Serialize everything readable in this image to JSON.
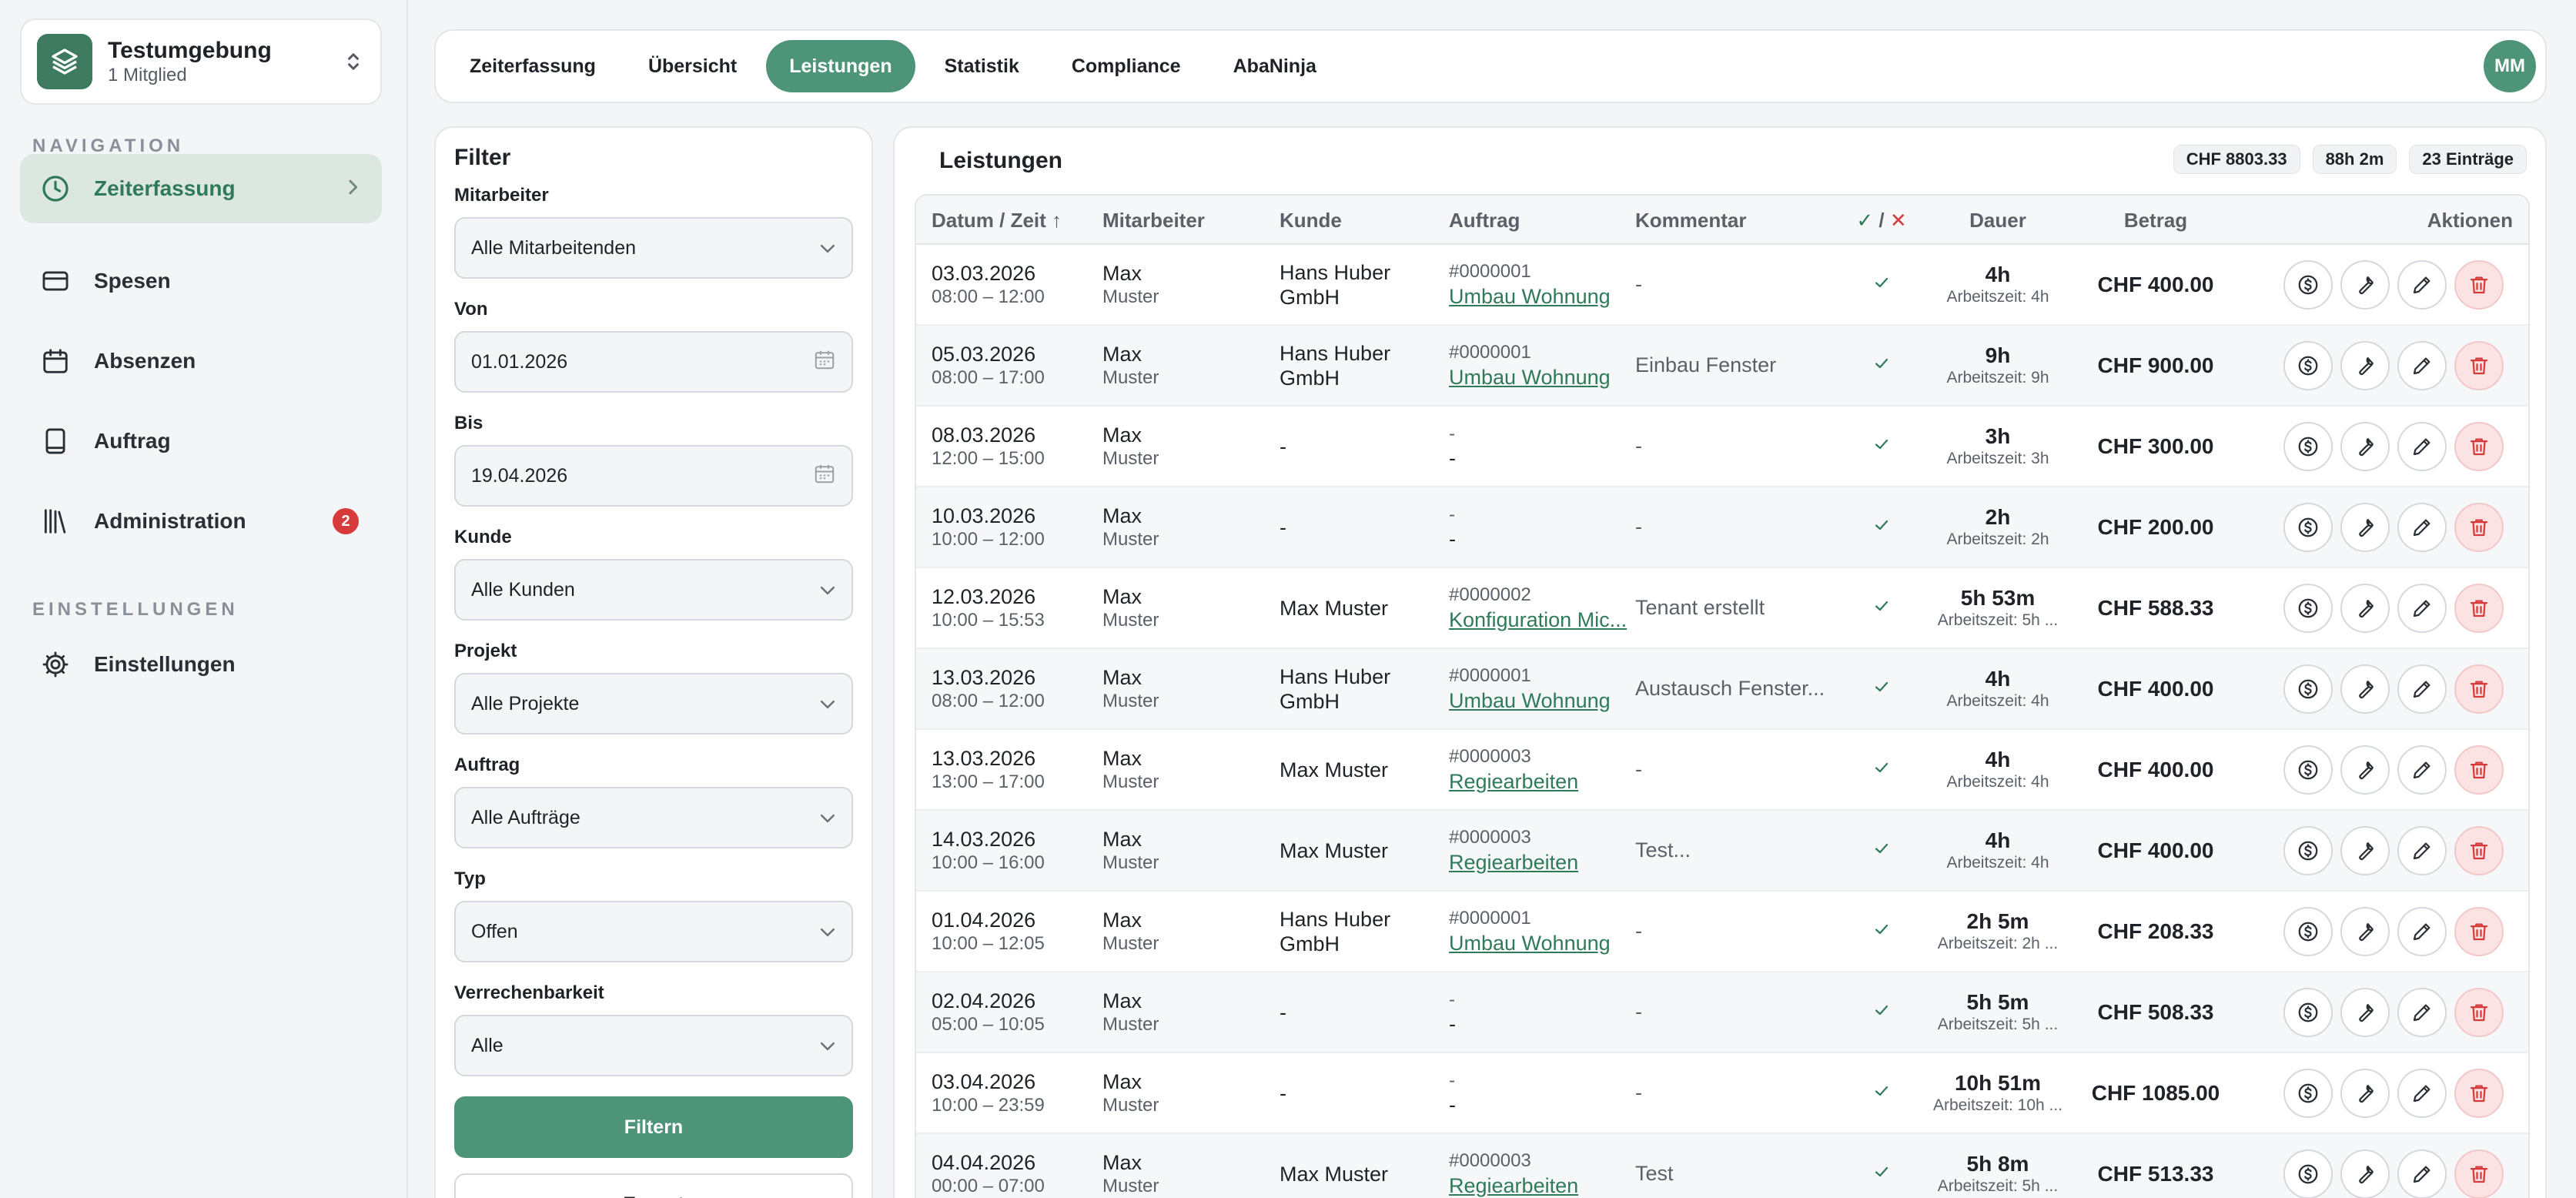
{
  "workspace": {
    "title": "Testumgebung",
    "subtitle": "1 Mitglied"
  },
  "sidebar": {
    "nav_heading": "NAVIGATION",
    "settings_heading": "EINSTELLUNGEN",
    "items": [
      {
        "label": "Zeiterfassung",
        "icon": "clock-icon",
        "active": true
      },
      {
        "label": "Spesen",
        "icon": "credit-card-icon"
      },
      {
        "label": "Absenzen",
        "icon": "calendar-icon"
      },
      {
        "label": "Auftrag",
        "icon": "tablet-icon"
      },
      {
        "label": "Administration",
        "icon": "library-icon",
        "badge": "2"
      }
    ],
    "settings_item": {
      "label": "Einstellungen",
      "icon": "gear-icon"
    }
  },
  "tabs": [
    {
      "label": "Zeiterfassung"
    },
    {
      "label": "Übersicht"
    },
    {
      "label": "Leistungen",
      "active": true
    },
    {
      "label": "Statistik"
    },
    {
      "label": "Compliance"
    },
    {
      "label": "AbaNinja"
    }
  ],
  "user": {
    "initials": "MM"
  },
  "filter": {
    "title": "Filter",
    "employee": {
      "label": "Mitarbeiter",
      "value": "Alle Mitarbeitenden"
    },
    "from": {
      "label": "Von",
      "value": "01.01.2026"
    },
    "to": {
      "label": "Bis",
      "value": "19.04.2026"
    },
    "customer": {
      "label": "Kunde",
      "value": "Alle Kunden"
    },
    "project": {
      "label": "Projekt",
      "value": "Alle Projekte"
    },
    "order": {
      "label": "Auftrag",
      "value": "Alle Aufträge"
    },
    "type": {
      "label": "Typ",
      "value": "Offen"
    },
    "billable": {
      "label": "Verrechenbarkeit",
      "value": "Alle"
    },
    "filter_button": "Filtern",
    "export_button": "Export"
  },
  "main": {
    "title": "Leistungen",
    "summary": {
      "amount": "CHF 8803.33",
      "hours": "88h 2m",
      "entries": "23 Einträge"
    },
    "columns": {
      "date": "Datum / Zeit ↑",
      "employee": "Mitarbeiter",
      "customer": "Kunde",
      "order": "Auftrag",
      "comment": "Kommentar",
      "status_check": "✓",
      "status_sep": " / ",
      "status_x": "✕",
      "duration": "Dauer",
      "amount": "Betrag",
      "actions": "Aktionen"
    },
    "rows": [
      {
        "date": "03.03.2026",
        "time": "08:00 – 12:00",
        "emp1": "Max",
        "emp2": "Muster",
        "cust1": "Hans Huber",
        "cust2": "GmbH",
        "order_no": "#0000001",
        "order_name": "Umbau Wohnung",
        "comment": "-",
        "dur": "4h",
        "dur_sub": "Arbeitszeit: 4h",
        "amount": "CHF 400.00"
      },
      {
        "date": "05.03.2026",
        "time": "08:00 – 17:00",
        "emp1": "Max",
        "emp2": "Muster",
        "cust1": "Hans Huber",
        "cust2": "GmbH",
        "order_no": "#0000001",
        "order_name": "Umbau Wohnung",
        "comment": "Einbau Fenster",
        "dur": "9h",
        "dur_sub": "Arbeitszeit: 9h",
        "amount": "CHF 900.00"
      },
      {
        "date": "08.03.2026",
        "time": "12:00 – 15:00",
        "emp1": "Max",
        "emp2": "Muster",
        "cust1": "-",
        "cust2": "",
        "order_no": "-",
        "order_name": "-",
        "comment": "-",
        "dur": "3h",
        "dur_sub": "Arbeitszeit: 3h",
        "amount": "CHF 300.00"
      },
      {
        "date": "10.03.2026",
        "time": "10:00 – 12:00",
        "emp1": "Max",
        "emp2": "Muster",
        "cust1": "-",
        "cust2": "",
        "order_no": "-",
        "order_name": "-",
        "comment": "-",
        "dur": "2h",
        "dur_sub": "Arbeitszeit: 2h",
        "amount": "CHF 200.00"
      },
      {
        "date": "12.03.2026",
        "time": "10:00 – 15:53",
        "emp1": "Max",
        "emp2": "Muster",
        "cust1": "Max Muster",
        "cust2": "",
        "order_no": "#0000002",
        "order_name": "Konfiguration Mic...",
        "comment": "Tenant erstellt",
        "dur": "5h 53m",
        "dur_sub": "Arbeitszeit: 5h ...",
        "amount": "CHF 588.33"
      },
      {
        "date": "13.03.2026",
        "time": "08:00 – 12:00",
        "emp1": "Max",
        "emp2": "Muster",
        "cust1": "Hans Huber",
        "cust2": "GmbH",
        "order_no": "#0000001",
        "order_name": "Umbau Wohnung",
        "comment": "Austausch Fenster...",
        "dur": "4h",
        "dur_sub": "Arbeitszeit: 4h",
        "amount": "CHF 400.00"
      },
      {
        "date": "13.03.2026",
        "time": "13:00 – 17:00",
        "emp1": "Max",
        "emp2": "Muster",
        "cust1": "Max Muster",
        "cust2": "",
        "order_no": "#0000003",
        "order_name": "Regiearbeiten",
        "comment": "-",
        "dur": "4h",
        "dur_sub": "Arbeitszeit: 4h",
        "amount": "CHF 400.00"
      },
      {
        "date": "14.03.2026",
        "time": "10:00 – 16:00",
        "emp1": "Max",
        "emp2": "Muster",
        "cust1": "Max Muster",
        "cust2": "",
        "order_no": "#0000003",
        "order_name": "Regiearbeiten",
        "comment": "Test...",
        "dur": "4h",
        "dur_sub": "Arbeitszeit: 4h",
        "amount": "CHF 400.00"
      },
      {
        "date": "01.04.2026",
        "time": "10:00 – 12:05",
        "emp1": "Max",
        "emp2": "Muster",
        "cust1": "Hans Huber",
        "cust2": "GmbH",
        "order_no": "#0000001",
        "order_name": "Umbau Wohnung",
        "comment": "-",
        "dur": "2h 5m",
        "dur_sub": "Arbeitszeit: 2h ...",
        "amount": "CHF 208.33"
      },
      {
        "date": "02.04.2026",
        "time": "05:00 – 10:05",
        "emp1": "Max",
        "emp2": "Muster",
        "cust1": "-",
        "cust2": "",
        "order_no": "-",
        "order_name": "-",
        "comment": "-",
        "dur": "5h 5m",
        "dur_sub": "Arbeitszeit: 5h ...",
        "amount": "CHF 508.33"
      },
      {
        "date": "03.04.2026",
        "time": "10:00 – 23:59",
        "emp1": "Max",
        "emp2": "Muster",
        "cust1": "-",
        "cust2": "",
        "order_no": "-",
        "order_name": "-",
        "comment": "-",
        "dur": "10h 51m",
        "dur_sub": "Arbeitszeit: 10h ...",
        "amount": "CHF 1085.00"
      },
      {
        "date": "04.04.2026",
        "time": "00:00 – 07:00",
        "emp1": "Max",
        "emp2": "Muster",
        "cust1": "Max Muster",
        "cust2": "",
        "order_no": "#0000003",
        "order_name": "Regiearbeiten",
        "comment": "Test",
        "dur": "5h 8m",
        "dur_sub": "Arbeitszeit: 5h ...",
        "amount": "CHF 513.33"
      }
    ]
  },
  "colors": {
    "accent": "#4e9478",
    "accent_dark": "#2f7a58",
    "danger": "#d63a3a",
    "check": "#2f7a58"
  }
}
